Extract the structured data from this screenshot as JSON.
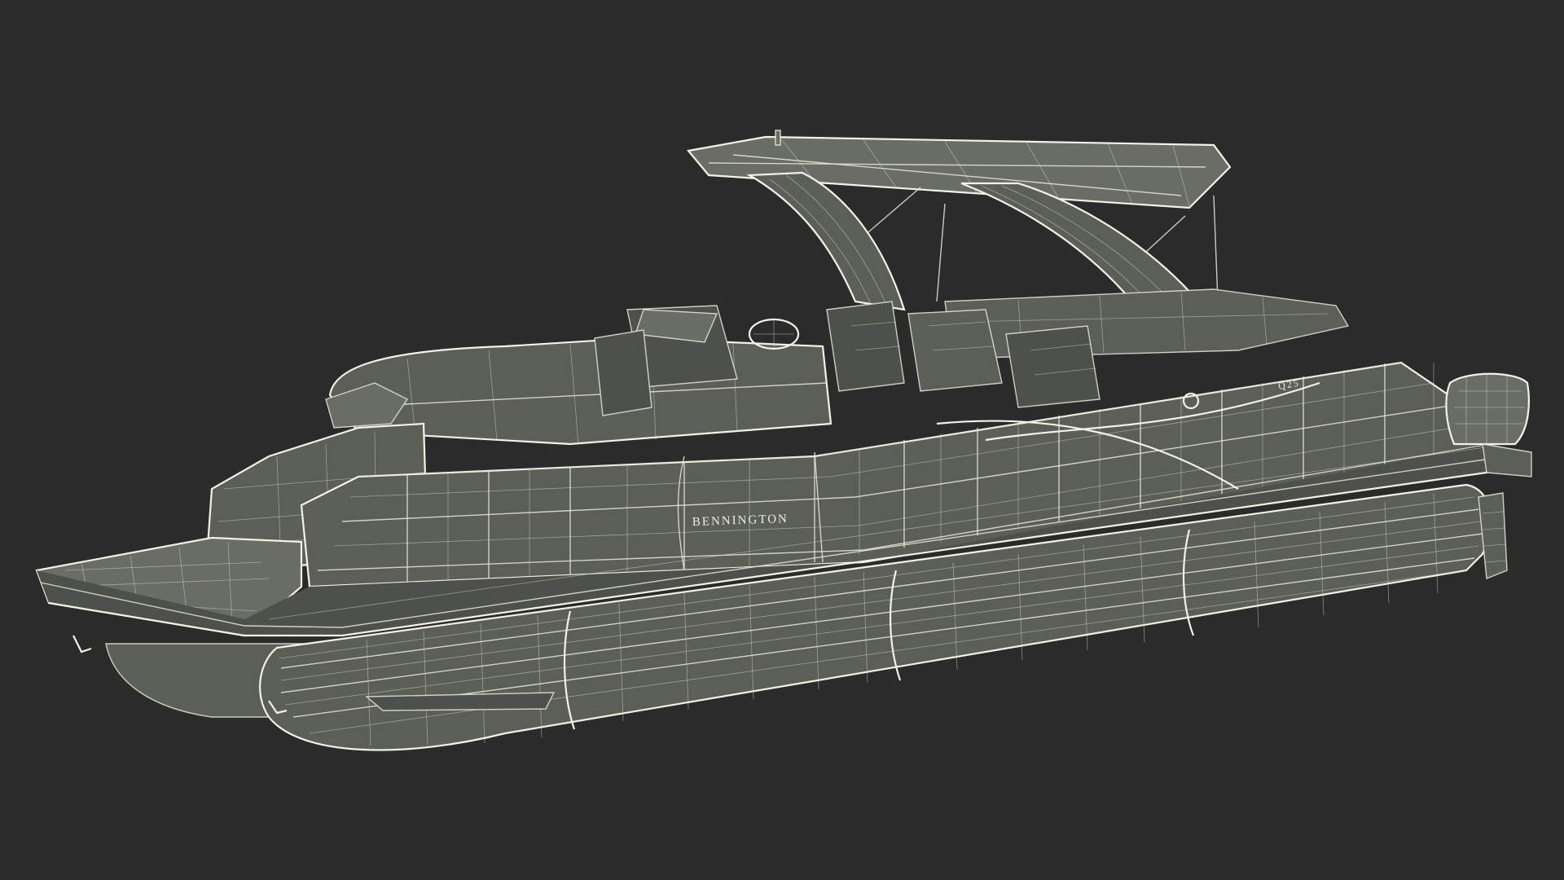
{
  "scene": {
    "background_color": "#2b2b2b",
    "model_color": "#5c5e58",
    "wire_color": "#e8e6d8"
  },
  "labels": {
    "brand": "BENNINGTON",
    "model_badge": "Q25"
  }
}
